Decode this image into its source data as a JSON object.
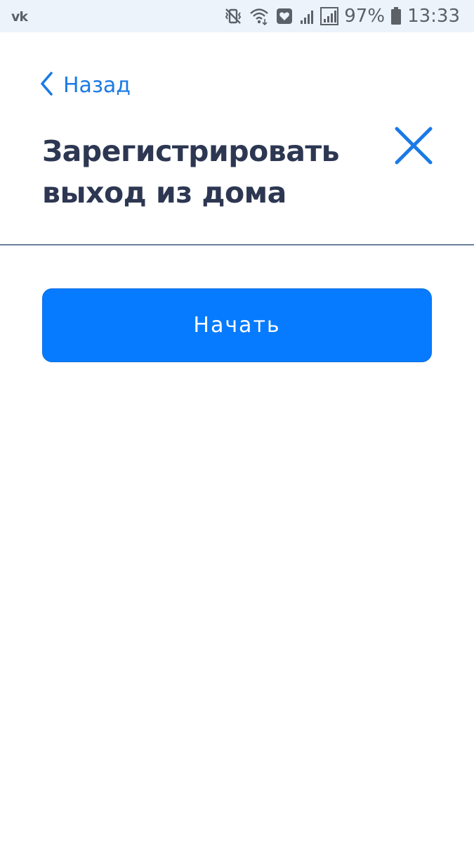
{
  "status_bar": {
    "left_icon": "vk-icon",
    "left_label": "vk",
    "icons": [
      "vibrate-mute-icon",
      "wifi-icon",
      "heart-notification-icon",
      "signal-weak-icon",
      "signal-icon"
    ],
    "battery_percent": "97%",
    "battery_icon": "battery-icon",
    "time": "13:33"
  },
  "header": {
    "back_label": "Назад",
    "back_icon": "chevron-left-icon",
    "title": "Зарегистрировать выход из дома",
    "close_icon": "close-icon"
  },
  "main": {
    "start_label": "Начать"
  },
  "colors": {
    "accent": "#077bff",
    "link": "#1a7ae6",
    "title": "#2d3752",
    "status_bar_bg": "#edf3fb",
    "divider": "#6b7f9a"
  }
}
